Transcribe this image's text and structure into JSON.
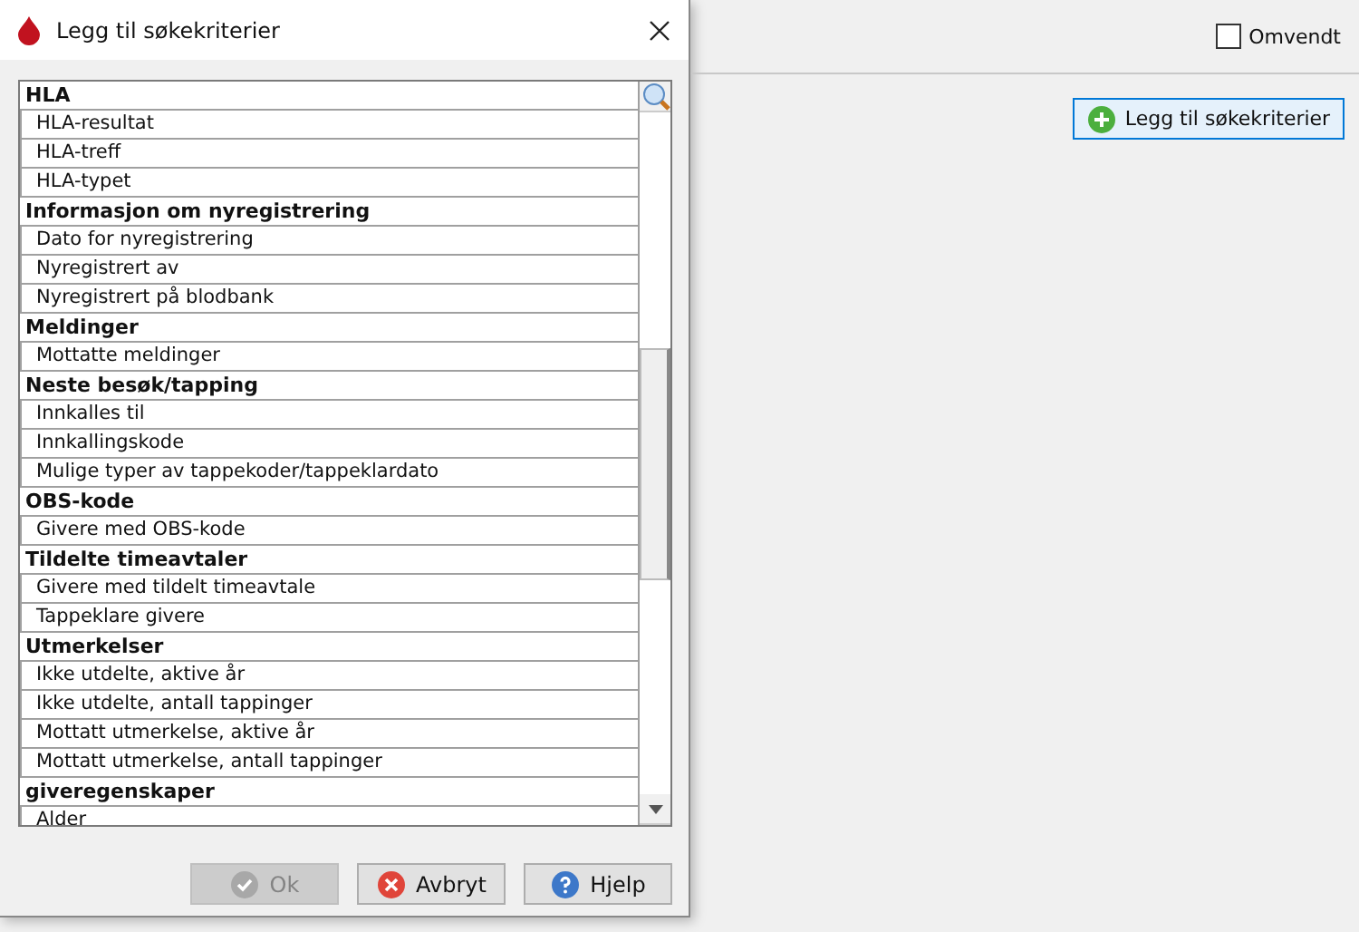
{
  "dialog": {
    "title": "Legg til søkekriterier",
    "rows": [
      {
        "kind": "header",
        "label": "HLA"
      },
      {
        "kind": "item",
        "label": "HLA-resultat"
      },
      {
        "kind": "item",
        "label": "HLA-treff"
      },
      {
        "kind": "item",
        "label": "HLA-typet"
      },
      {
        "kind": "header",
        "label": "Informasjon om nyregistrering"
      },
      {
        "kind": "item",
        "label": "Dato for nyregistrering"
      },
      {
        "kind": "item",
        "label": "Nyregistrert av"
      },
      {
        "kind": "item",
        "label": "Nyregistrert på blodbank"
      },
      {
        "kind": "header",
        "label": "Meldinger"
      },
      {
        "kind": "item",
        "label": "Mottatte meldinger"
      },
      {
        "kind": "header",
        "label": "Neste besøk/tapping"
      },
      {
        "kind": "item",
        "label": "Innkalles til"
      },
      {
        "kind": "item",
        "label": "Innkallingskode"
      },
      {
        "kind": "item",
        "label": "Mulige typer av tappekoder/tappeklardato"
      },
      {
        "kind": "header",
        "label": "OBS-kode"
      },
      {
        "kind": "item",
        "label": "Givere med OBS-kode"
      },
      {
        "kind": "header",
        "label": "Tildelte timeavtaler"
      },
      {
        "kind": "item",
        "label": "Givere med tildelt timeavtale"
      },
      {
        "kind": "item",
        "label": "Tappeklare givere"
      },
      {
        "kind": "header",
        "label": "Utmerkelser"
      },
      {
        "kind": "item",
        "label": "Ikke utdelte, aktive år"
      },
      {
        "kind": "item",
        "label": "Ikke utdelte, antall tappinger"
      },
      {
        "kind": "item",
        "label": "Mottatt utmerkelse, aktive år"
      },
      {
        "kind": "item",
        "label": "Mottatt utmerkelse, antall tappinger"
      },
      {
        "kind": "header",
        "label": "giveregenskaper"
      },
      {
        "kind": "item",
        "label": "Alder"
      }
    ],
    "buttons": [
      {
        "kind": "ok",
        "label": "Ok",
        "disabled": true
      },
      {
        "kind": "cancel",
        "label": "Avbryt",
        "disabled": false
      },
      {
        "kind": "help",
        "label": "Hjelp",
        "disabled": false
      }
    ]
  },
  "omvendt": {
    "label": "Omvendt",
    "checked": false
  },
  "add_button": {
    "label": "Legg til søkekriterier"
  }
}
